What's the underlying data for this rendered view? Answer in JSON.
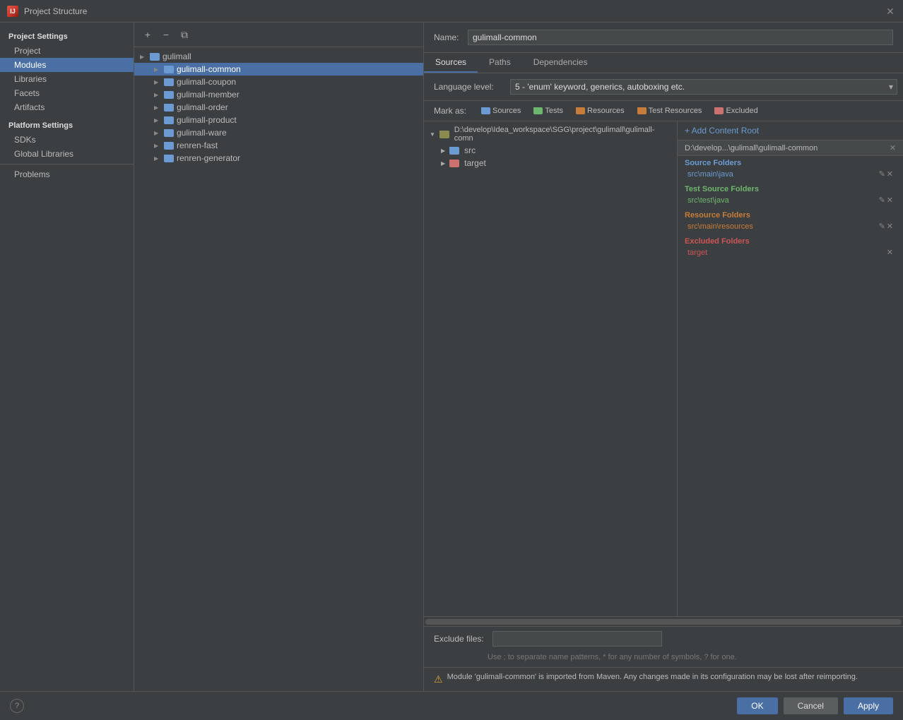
{
  "titleBar": {
    "title": "Project Structure",
    "closeLabel": "✕"
  },
  "sidebar": {
    "projectSettingsLabel": "Project Settings",
    "items": [
      {
        "id": "project",
        "label": "Project",
        "active": false
      },
      {
        "id": "modules",
        "label": "Modules",
        "active": true
      },
      {
        "id": "libraries",
        "label": "Libraries",
        "active": false
      },
      {
        "id": "facets",
        "label": "Facets",
        "active": false
      },
      {
        "id": "artifacts",
        "label": "Artifacts",
        "active": false
      }
    ],
    "platformLabel": "Platform Settings",
    "platformItems": [
      {
        "id": "sdks",
        "label": "SDKs"
      },
      {
        "id": "global-libraries",
        "label": "Global Libraries"
      }
    ],
    "problemsLabel": "Problems"
  },
  "moduleTree": {
    "modules": [
      {
        "id": "gulimall",
        "label": "gulimall",
        "indent": 0,
        "expanded": true,
        "selected": false
      },
      {
        "id": "gulimall-common",
        "label": "gulimall-common",
        "indent": 1,
        "expanded": false,
        "selected": true
      },
      {
        "id": "gulimall-coupon",
        "label": "gulimall-coupon",
        "indent": 1,
        "expanded": false,
        "selected": false
      },
      {
        "id": "gulimall-member",
        "label": "gulimall-member",
        "indent": 1,
        "expanded": false,
        "selected": false
      },
      {
        "id": "gulimall-order",
        "label": "gulimall-order",
        "indent": 1,
        "expanded": false,
        "selected": false
      },
      {
        "id": "gulimall-product",
        "label": "gulimall-product",
        "indent": 1,
        "expanded": false,
        "selected": false
      },
      {
        "id": "gulimall-ware",
        "label": "gulimall-ware",
        "indent": 1,
        "expanded": false,
        "selected": false
      },
      {
        "id": "renren-fast",
        "label": "renren-fast",
        "indent": 1,
        "expanded": false,
        "selected": false
      },
      {
        "id": "renren-generator",
        "label": "renren-generator",
        "indent": 1,
        "expanded": false,
        "selected": false
      }
    ],
    "addBtn": "+",
    "removeBtn": "−",
    "copyBtn": "⧉"
  },
  "rightPanel": {
    "nameLabel": "Name:",
    "nameValue": "gulimall-common",
    "tabs": [
      {
        "id": "sources",
        "label": "Sources",
        "active": true
      },
      {
        "id": "paths",
        "label": "Paths",
        "active": false
      },
      {
        "id": "dependencies",
        "label": "Dependencies",
        "active": false
      }
    ],
    "languageLevelLabel": "Language level:",
    "languageLevelValue": "5 - 'enum' keyword, generics, autoboxing etc.",
    "markAsLabel": "Mark as:",
    "markButtons": [
      {
        "id": "sources",
        "label": "Sources"
      },
      {
        "id": "tests",
        "label": "Tests"
      },
      {
        "id": "resources",
        "label": "Resources"
      },
      {
        "id": "test-resources",
        "label": "Test Resources"
      },
      {
        "id": "excluded",
        "label": "Excluded"
      }
    ],
    "fileTree": [
      {
        "id": "root-path",
        "label": "D:\\develop\\Idea_workspace\\SGG\\project\\gulimall\\gulimall-comn",
        "indent": 0,
        "expanded": true
      },
      {
        "id": "src",
        "label": "src",
        "indent": 1,
        "expanded": false
      },
      {
        "id": "target",
        "label": "target",
        "indent": 1,
        "expanded": false
      }
    ],
    "excludeLabel": "Exclude files:",
    "excludeHint": "Use ; to separate name patterns, * for any number of symbols, ? for one.",
    "warningText": "Module 'gulimall-common' is imported from Maven. Any changes made in its configuration may be lost after reimporting."
  },
  "rootsPanel": {
    "addContentRootLabel": "+ Add Content Root",
    "pathHeader": "D:\\develop...\\gulimall\\gulimall-common",
    "sections": [
      {
        "id": "source-folders",
        "title": "Source Folders",
        "type": "sources",
        "items": [
          "src\\main\\java"
        ]
      },
      {
        "id": "test-source-folders",
        "title": "Test Source Folders",
        "type": "tests",
        "items": [
          "src\\test\\java"
        ]
      },
      {
        "id": "resource-folders",
        "title": "Resource Folders",
        "type": "resources",
        "items": [
          "src\\main\\resources"
        ]
      },
      {
        "id": "excluded-folders",
        "title": "Excluded Folders",
        "type": "excluded",
        "items": [
          "target"
        ]
      }
    ]
  },
  "bottomBar": {
    "helpLabel": "?",
    "okLabel": "OK",
    "cancelLabel": "Cancel",
    "applyLabel": "Apply"
  }
}
